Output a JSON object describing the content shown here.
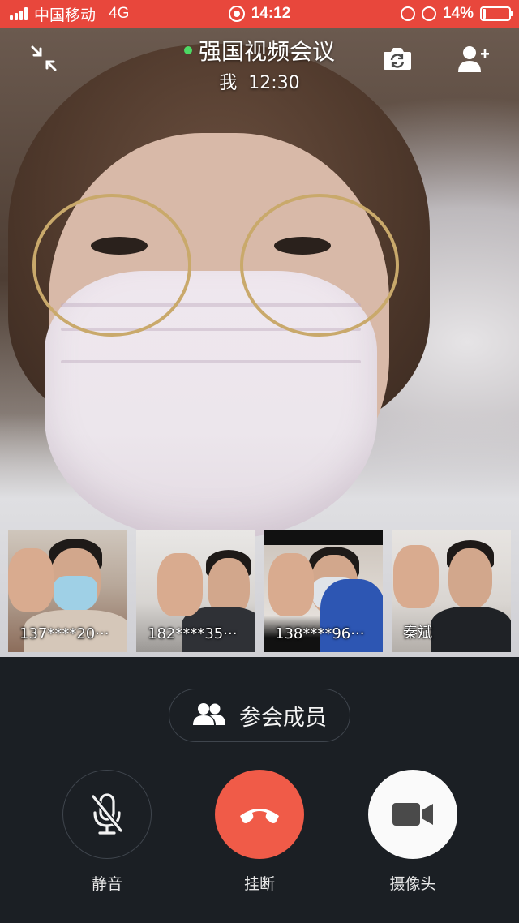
{
  "status_bar": {
    "carrier": "中国移动",
    "network": "4G",
    "time": "14:12",
    "battery": "14%",
    "battery_level": 0.14
  },
  "header": {
    "title": "强国视频会议",
    "subtitle": "我  12:30",
    "icons": [
      "minimize-icon",
      "switch-camera-icon",
      "add-participant-icon"
    ]
  },
  "participants": [
    {
      "label": "137****20···"
    },
    {
      "label": "182****35···"
    },
    {
      "label": "138****96···"
    },
    {
      "label": "秦斌"
    }
  ],
  "controls": {
    "members_label": "参会成员",
    "mute_label": "静音",
    "hangup_label": "挂断",
    "camera_label": "摄像头"
  },
  "colors": {
    "status_bar": "#e8473c",
    "panel": "#1b1f24",
    "hangup": "#f05b48",
    "online_dot": "#4cd964"
  }
}
